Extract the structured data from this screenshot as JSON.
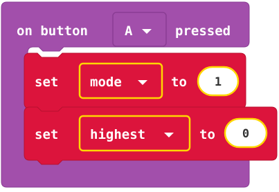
{
  "event_block": {
    "label_on": "on button",
    "button_value": "A",
    "label_pressed": "pressed"
  },
  "statements": [
    {
      "keyword": "set",
      "variable": "mode",
      "to_label": "to",
      "value": "1"
    },
    {
      "keyword": "set",
      "variable": "highest",
      "to_label": "to",
      "value": "0"
    }
  ],
  "colors": {
    "event_block": "#a24fab",
    "event_block_dark": "#8a3d94",
    "variables_block": "#dc143c",
    "variables_block_dark": "#b8102f",
    "highlight_outline": "#ffd700",
    "text": "#ffffff",
    "value_text": "#333333",
    "background": "#ffffff"
  },
  "icons": [
    "dropdown-triangle-icon"
  ]
}
